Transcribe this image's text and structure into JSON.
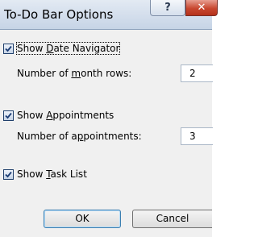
{
  "dialog": {
    "title": "To-Do Bar Options",
    "help_glyph": "?",
    "close_glyph": "✕"
  },
  "options": {
    "date_navigator": {
      "checked": true,
      "label_pre": "Show ",
      "label_key": "D",
      "label_post": "ate Navigator",
      "sub_label_pre": "Number of ",
      "sub_label_key": "m",
      "sub_label_post": "onth rows:",
      "value": "2"
    },
    "appointments": {
      "checked": true,
      "label_pre": "Show ",
      "label_key": "A",
      "label_post": "ppointments",
      "sub_label_pre": "Number of a",
      "sub_label_key": "p",
      "sub_label_post": "pointments:",
      "value": "3"
    },
    "task_list": {
      "checked": true,
      "label_pre": "Show ",
      "label_key": "T",
      "label_post": "ask List"
    }
  },
  "buttons": {
    "ok": "OK",
    "cancel": "Cancel"
  }
}
